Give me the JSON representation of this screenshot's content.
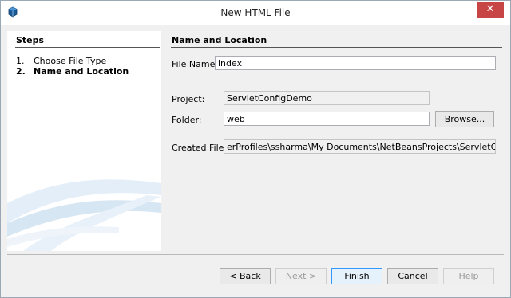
{
  "window": {
    "title": "New HTML File",
    "close_glyph": "✕"
  },
  "steps": {
    "heading": "Steps",
    "items": [
      {
        "num": "1.",
        "label": "Choose File Type"
      },
      {
        "num": "2.",
        "label": "Name and Location"
      }
    ]
  },
  "main": {
    "heading": "Name and Location",
    "file_name_label": "File Name:",
    "file_name_value": "index",
    "project_label": "Project:",
    "project_value": "ServletConfigDemo",
    "folder_label": "Folder:",
    "folder_value": "web",
    "browse_label": "Browse...",
    "created_label": "Created File:",
    "created_value": "erProfiles\\ssharma\\My Documents\\NetBeansProjects\\ServletConfigDem"
  },
  "buttons": {
    "back": "< Back",
    "next": "Next >",
    "finish": "Finish",
    "cancel": "Cancel",
    "help": "Help"
  },
  "colors": {
    "close": "#c74545",
    "accent": "#3399ff",
    "deco_blue": "#d7e6f3"
  },
  "icons": {
    "app": "netbeans-cube-icon",
    "close": "close-icon"
  }
}
